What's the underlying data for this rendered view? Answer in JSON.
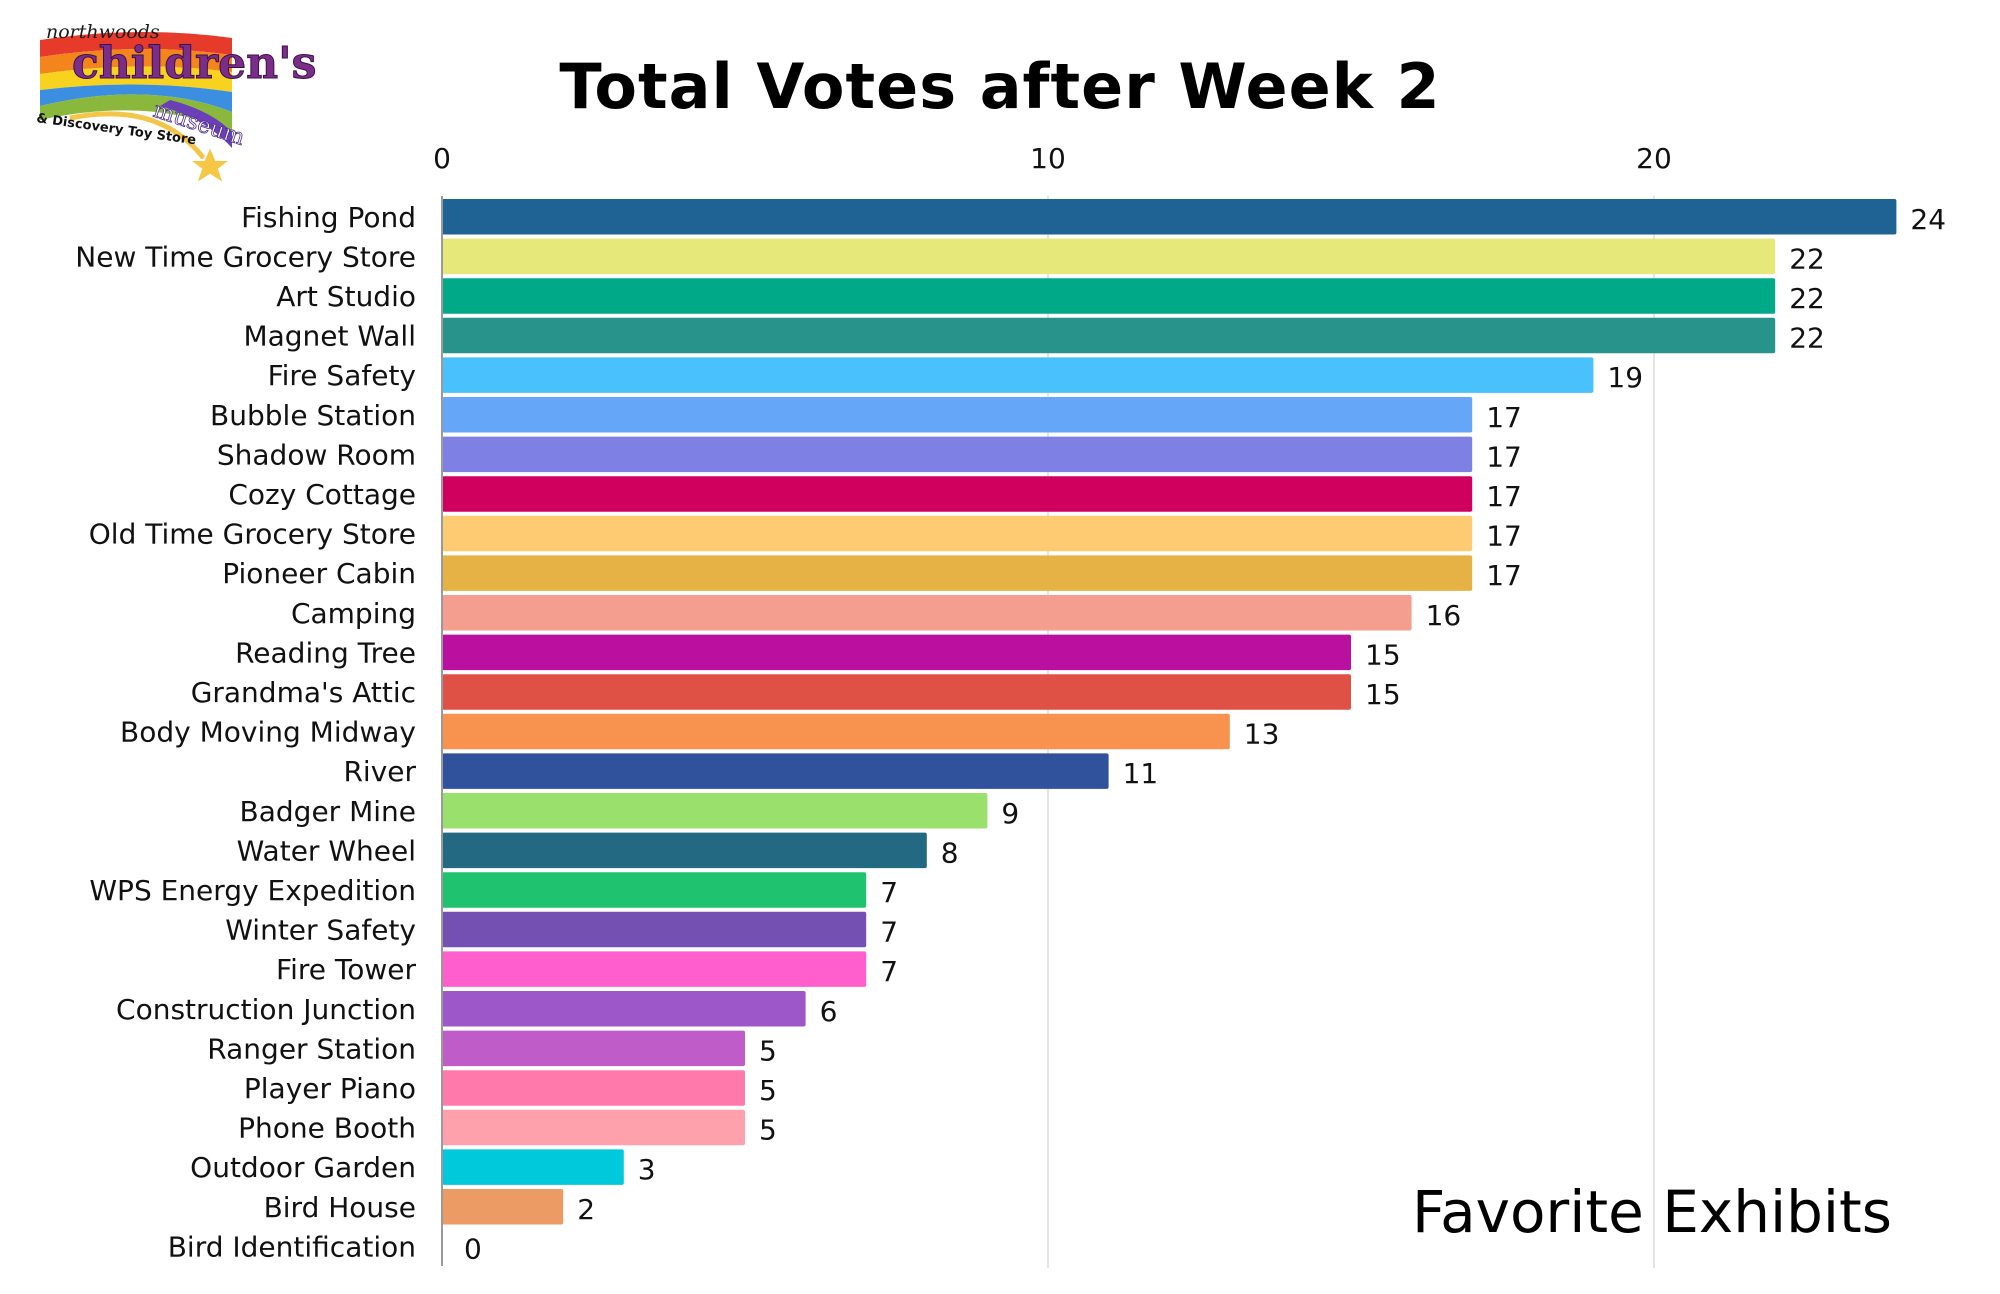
{
  "logo": {
    "line1": "northwoods",
    "line2": "children's",
    "line3": "museum",
    "line4": "& Discovery Toy Store",
    "icon": "rainbow-star-logo"
  },
  "chart_data": {
    "type": "bar",
    "orientation": "horizontal",
    "title": "Total Votes after Week 2",
    "subtitle": "Favorite Exhibits",
    "xlabel": "",
    "ylabel": "",
    "xlim": [
      0,
      24
    ],
    "xticks": [
      0,
      10,
      20
    ],
    "x_axis_position": "top",
    "grid": true,
    "legend": "none",
    "data_labels": true,
    "categories": [
      "Fishing Pond",
      "New Time Grocery Store",
      "Art Studio",
      "Magnet Wall",
      "Fire Safety",
      "Bubble Station",
      "Shadow Room",
      "Cozy Cottage",
      "Old Time Grocery Store",
      "Pioneer Cabin",
      "Camping",
      "Reading Tree",
      "Grandma's Attic",
      "Body Moving Midway",
      "River",
      "Badger Mine",
      "Water Wheel",
      "WPS Energy Expedition",
      "Winter Safety",
      "Fire Tower",
      "Construction Junction",
      "Ranger Station",
      "Player Piano",
      "Phone Booth",
      "Outdoor Garden",
      "Bird House",
      "Bird Identification"
    ],
    "values": [
      24,
      22,
      22,
      22,
      19,
      17,
      17,
      17,
      17,
      17,
      16,
      15,
      15,
      13,
      11,
      9,
      8,
      7,
      7,
      7,
      6,
      5,
      5,
      5,
      3,
      2,
      0
    ],
    "colors": [
      "#1f6394",
      "#e6e87a",
      "#00aa88",
      "#27938a",
      "#48c1fd",
      "#65a6f8",
      "#7e80e4",
      "#d0005f",
      "#fecb73",
      "#e6b246",
      "#f49e90",
      "#ba10a0",
      "#e05145",
      "#f7924f",
      "#30529d",
      "#9ae06c",
      "#236981",
      "#1fc26e",
      "#7350b1",
      "#ff5ecc",
      "#9d57c9",
      "#c05cc7",
      "#ff7aab",
      "#ffa1ad",
      "#00c9db",
      "#eb9b63",
      "#cccccc"
    ]
  }
}
